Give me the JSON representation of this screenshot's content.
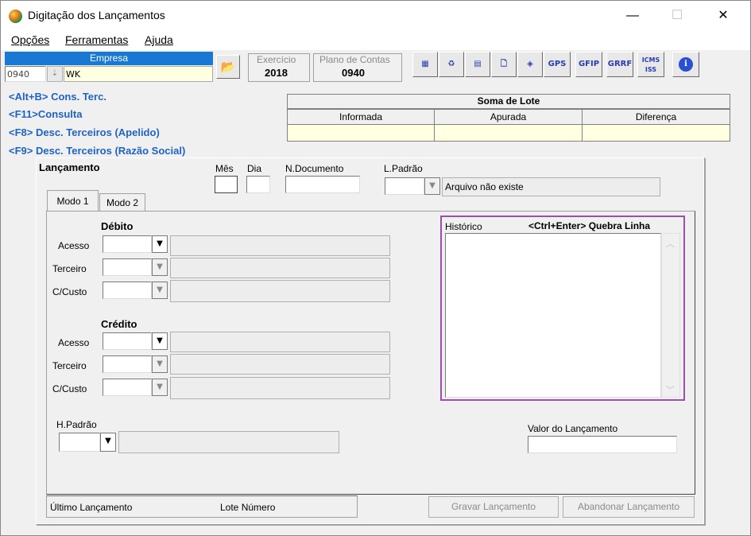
{
  "window": {
    "title": "Digitação dos Lançamentos",
    "minimize": "—",
    "maximize": "☐",
    "close": "✕"
  },
  "menu": [
    "Opções",
    "Ferramentas",
    "Ajuda"
  ],
  "empresa": {
    "label": "Empresa",
    "code": "0940",
    "name": "WK"
  },
  "exercicio": {
    "label": "Exercício",
    "value": "2018"
  },
  "plano": {
    "label": "Plano de Contas",
    "value": "0940"
  },
  "toolbar": {
    "gps": "GPS",
    "gfip": "GFIP",
    "grrf": "GRRF",
    "icms_iss": "ICMS ISS",
    "info": "i"
  },
  "shortcuts": [
    "<Alt+B> Cons. Terc.",
    "<F11>Consulta",
    "<F8> Desc. Terceiros (Apelido)",
    "<F9> Desc. Terceiros (Razão Social)"
  ],
  "soma_lote": {
    "title": "Soma de Lote",
    "cols": [
      "Informada",
      "Apurada",
      "Diferença"
    ]
  },
  "lancamento": {
    "title": "Lançamento",
    "mes": "Mês",
    "dia": "Dia",
    "ndoc": "N.Documento",
    "lpadrao": "L.Padrão",
    "arquivo": "Arquivo não existe"
  },
  "tabs": [
    "Modo 1",
    "Modo 2"
  ],
  "debito": {
    "title": "Débito",
    "rows": [
      "Acesso",
      "Terceiro",
      "C/Custo"
    ]
  },
  "credito": {
    "title": "Crédito",
    "rows": [
      "Acesso",
      "Terceiro",
      "C/Custo"
    ]
  },
  "hpadrao": "H.Padrão",
  "historico": {
    "label": "Histórico",
    "hint": "<Ctrl+Enter> Quebra Linha"
  },
  "valor": "Valor do Lançamento",
  "status": {
    "ultimo": "Último Lançamento",
    "lote": "Lote Número"
  },
  "buttons": {
    "gravar": "Gravar Lançamento",
    "abandonar": "Abandonar Lançamento"
  },
  "colors": {
    "accent": "#1978d4",
    "link": "#1f63c4",
    "yellow": "#ffffe1",
    "focus": "#9b4fa8"
  }
}
